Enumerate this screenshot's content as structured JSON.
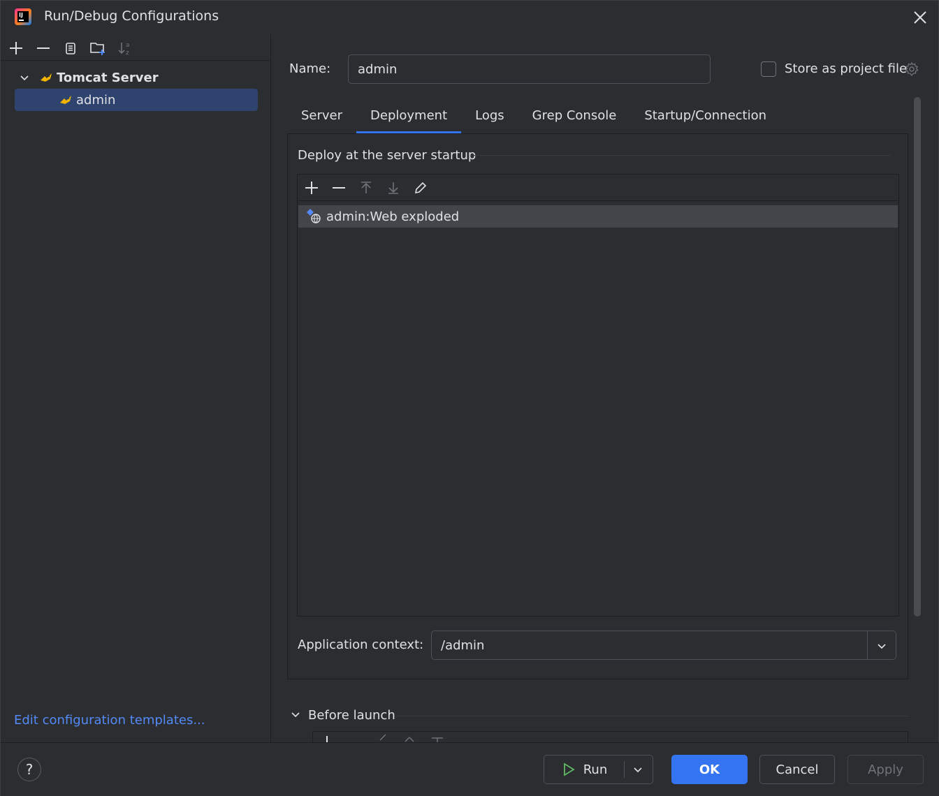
{
  "window": {
    "title": "Run/Debug Configurations"
  },
  "tree": {
    "group_label": "Tomcat Server",
    "item_label": "admin"
  },
  "left": {
    "edit_templates_link": "Edit configuration templates..."
  },
  "form": {
    "name_label": "Name:",
    "name_value": "admin",
    "store_label": "Store as project file",
    "store_checked": false
  },
  "tabs": [
    {
      "label": "Server",
      "active": false
    },
    {
      "label": "Deployment",
      "active": true
    },
    {
      "label": "Logs",
      "active": false
    },
    {
      "label": "Grep Console",
      "active": false
    },
    {
      "label": "Startup/Connection",
      "active": false
    }
  ],
  "deployment": {
    "section_title": "Deploy at the server startup",
    "artifacts": [
      {
        "label": "admin:Web exploded"
      }
    ],
    "context_label": "Application context:",
    "context_value": "/admin"
  },
  "before_launch": {
    "label": "Before launch"
  },
  "buttons": {
    "help": "?",
    "run": "Run",
    "ok": "OK",
    "cancel": "Cancel",
    "apply": "Apply"
  },
  "colors": {
    "accent": "#3574f0",
    "link": "#548af7",
    "selection": "#2e436e",
    "tomcat": "#f0b400"
  }
}
